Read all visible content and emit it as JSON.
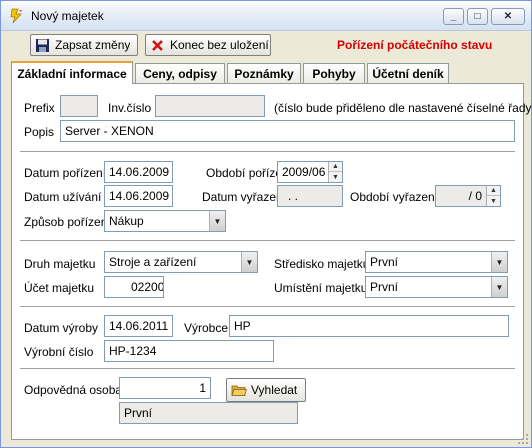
{
  "window": {
    "title": "Nový majetek",
    "controls": {
      "minimize": "_",
      "maximize": "□",
      "close": "✕"
    }
  },
  "toolbar": {
    "save_label": "Zapsat změny",
    "quit_label": "Konec bez uložení",
    "status": "Pořízení počátečního stavu",
    "status_color": "#d40000"
  },
  "tabs": [
    {
      "label": "Základní informace",
      "active": true
    },
    {
      "label": "Ceny, odpisy"
    },
    {
      "label": "Poznámky"
    },
    {
      "label": "Pohyby"
    },
    {
      "label": "Účetní deník"
    }
  ],
  "form": {
    "prefix": {
      "label": "Prefix",
      "value": ""
    },
    "inv_cislo": {
      "label": "Inv.číslo",
      "value": ""
    },
    "inv_note": "(číslo bude přiděleno dle nastavené číselné řady)",
    "popis": {
      "label": "Popis",
      "value": "Server - XENON"
    },
    "datum_porizeni": {
      "label": "Datum pořízení",
      "value": "14.06.2009"
    },
    "obdobi_porizeni": {
      "label": "Období pořízení",
      "value": "2009/06"
    },
    "datum_uzivani": {
      "label": "Datum užívání",
      "value": "14.06.2009"
    },
    "datum_vyrazeni": {
      "label": "Datum vyřazení",
      "value": " .  ."
    },
    "obdobi_vyrazeni": {
      "label": "Období vyřazení",
      "value": "/ 0"
    },
    "zpusob_porizeni": {
      "label": "Způsob pořízení",
      "value": "Nákup"
    },
    "druh_majetku": {
      "label": "Druh majetku",
      "value": "Stroje a zařízení"
    },
    "stredisko_majetku": {
      "label": "Středisko majetku",
      "value": "První"
    },
    "ucet_majetku": {
      "label": "Účet majetku",
      "value": "02200"
    },
    "umisteni_majetku": {
      "label": "Umístění majetku",
      "value": "První"
    },
    "datum_vyroby": {
      "label": "Datum výroby",
      "value": "14.06.2011"
    },
    "vyrobce": {
      "label": "Výrobce",
      "value": "HP"
    },
    "vyrobni_cislo": {
      "label": "Výrobní číslo",
      "value": "HP-1234"
    },
    "odpovedna_osoba": {
      "label": "Odpovědná osoba",
      "value": "1",
      "name": "První"
    },
    "search_label": "Vyhledat"
  },
  "icons": {
    "app": "lightning-icon",
    "save": "floppy-disk-icon",
    "quit": "red-x-icon",
    "search": "open-folder-icon",
    "combo": "chevron-down-icon"
  }
}
